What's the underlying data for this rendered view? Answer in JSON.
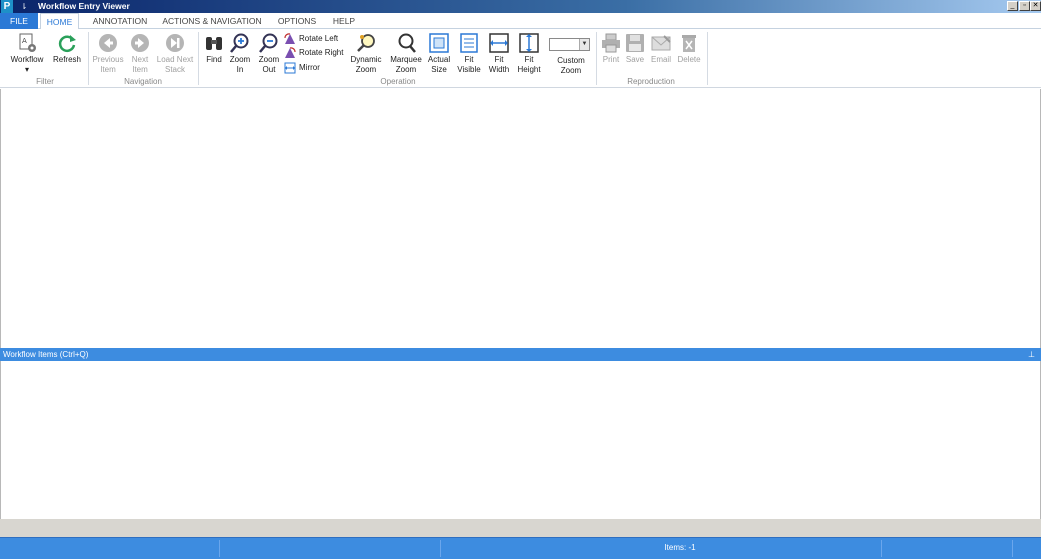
{
  "window": {
    "app_icon_letter": "P",
    "quick_access": "⇂",
    "title": "Workflow Entry Viewer",
    "controls": [
      "_",
      "▫",
      "✕"
    ]
  },
  "tabs": {
    "file": "FILE",
    "home": "HOME",
    "annotation": "ANNOTATION",
    "actions": "ACTIONS & NAVIGATION",
    "options": "OPTIONS",
    "help": "HELP"
  },
  "ribbon": {
    "filter": {
      "label": "Filter",
      "workflow": "Workflow",
      "workflow_arrow": "▾",
      "refresh": "Refresh"
    },
    "navigation": {
      "label": "Navigation",
      "previous_1": "Previous",
      "previous_2": "Item",
      "next_1": "Next",
      "next_2": "Item",
      "load_1": "Load Next",
      "load_2": "Stack"
    },
    "operation": {
      "label": "Operation",
      "find": "Find",
      "zoom_in_1": "Zoom",
      "zoom_in_2": "In",
      "zoom_out_1": "Zoom",
      "zoom_out_2": "Out",
      "rotate_left": "Rotate Left",
      "rotate_right": "Rotate Right",
      "mirror": "Mirror",
      "dynamic_1": "Dynamic",
      "dynamic_2": "Zoom",
      "marquee_1": "Marquee",
      "marquee_2": "Zoom",
      "actual_1": "Actual",
      "actual_2": "Size",
      "fit_visible_1": "Fit",
      "fit_visible_2": "Visible",
      "fit_width_1": "Fit",
      "fit_width_2": "Width",
      "fit_height_1": "Fit",
      "fit_height_2": "Height",
      "custom_1": "Custom",
      "custom_2": "Zoom",
      "combo_value": ""
    },
    "reproduction": {
      "label": "Reproduction",
      "print": "Print",
      "save": "Save",
      "email": "Email",
      "delete": "Delete"
    }
  },
  "panel": {
    "title": "Workflow Items (Ctrl+Q)",
    "pin": "⊥"
  },
  "statusbar": {
    "items": "Items: -1"
  },
  "colors": {
    "accent": "#3d8ce0",
    "file_tab": "#2b79d6",
    "disabled": "#a0a0a0"
  }
}
